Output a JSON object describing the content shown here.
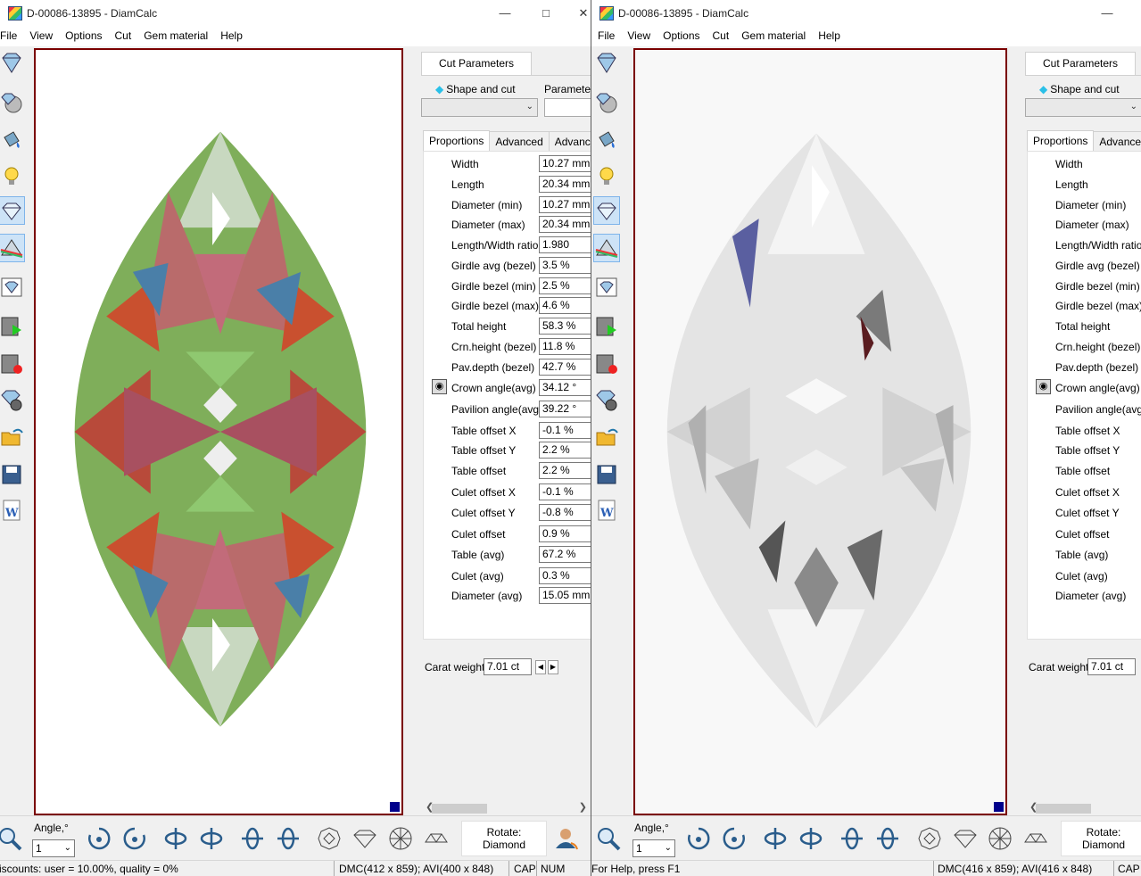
{
  "windows": [
    {
      "title": "D-00086-13895 - DiamCalc",
      "menu": [
        "File",
        "View",
        "Options",
        "Cut",
        "Gem material",
        "Help"
      ],
      "panel_tab": "Cut Parameters",
      "shape_label": "Shape and cut",
      "parameter_label": "Parameter",
      "subtabs": [
        "Proportions",
        "Advanced",
        "Advanced"
      ],
      "params": [
        {
          "label": "Width",
          "value": "10.27 mm"
        },
        {
          "label": "Length",
          "value": "20.34 mm"
        },
        {
          "label": "Diameter (min)",
          "value": "10.27 mm"
        },
        {
          "label": "Diameter (max)",
          "value": "20.34 mm"
        },
        {
          "label": "Length/Width ratio",
          "value": "1.980"
        },
        {
          "label": "Girdle avg (bezel)",
          "value": "3.5 %"
        },
        {
          "label": "Girdle bezel (min)",
          "value": "2.5 %"
        },
        {
          "label": "Girdle bezel (max)",
          "value": "4.6 %"
        },
        {
          "label": "Total height",
          "value": "58.3 %"
        },
        {
          "label": "Crn.height (bezel)",
          "value": "11.8 %"
        },
        {
          "label": "Pav.depth (bezel)",
          "value": "42.7 %"
        },
        {
          "label": "Crown angle(avg)",
          "value": "34.12 °"
        },
        {
          "label": "Pavilion angle(avg)",
          "value": "39.22 °"
        },
        {
          "label": "Table offset X",
          "value": "-0.1 %"
        },
        {
          "label": "Table offset Y",
          "value": "2.2 %"
        },
        {
          "label": "Table offset",
          "value": "2.2 %"
        },
        {
          "label": "Culet offset X",
          "value": "-0.1 %"
        },
        {
          "label": "Culet offset Y",
          "value": "-0.8 %"
        },
        {
          "label": "Culet offset",
          "value": "0.9 %"
        },
        {
          "label": "Table (avg)",
          "value": "67.2 %"
        },
        {
          "label": "Culet (avg)",
          "value": "0.3 %"
        },
        {
          "label": "Diameter (avg)",
          "value": "15.05 mm"
        }
      ],
      "carat_label": "Carat weight",
      "carat_value": "7.01 ct",
      "angle_label": "Angle,°",
      "angle_value": "1",
      "rotate_label": "Rotate:",
      "rotate_value": "Diamond",
      "status_left": "iscounts: user = 10.00%, quality = 0%",
      "status_dmc": "DMC(412 x 859); AVI(400 x 848)",
      "status_cap": "CAP",
      "status_num": "NUM"
    },
    {
      "title": "D-00086-13895 - DiamCalc",
      "menu": [
        "File",
        "View",
        "Options",
        "Cut",
        "Gem material",
        "Help"
      ],
      "panel_tab": "Cut Parameters",
      "shape_label": "Shape and cut",
      "subtabs": [
        "Proportions",
        "Advanced"
      ],
      "params": [
        "Width",
        "Length",
        "Diameter (min)",
        "Diameter (max)",
        "Length/Width ratio",
        "Girdle avg (bezel)",
        "Girdle bezel (min)",
        "Girdle bezel (max)",
        "Total height",
        "Crn.height (bezel)",
        "Pav.depth (bezel)",
        "Crown angle(avg)",
        "Pavilion angle(avg)",
        "Table offset X",
        "Table offset Y",
        "Table offset",
        "Culet offset X",
        "Culet offset Y",
        "Culet offset",
        "Table (avg)",
        "Culet (avg)",
        "Diameter (avg)"
      ],
      "carat_label": "Carat weight",
      "carat_value": "7.01 ct",
      "angle_label": "Angle,°",
      "angle_value": "1",
      "rotate_label": "Rotate:",
      "rotate_value": "Diamond",
      "status_left": "For Help, press F1",
      "status_dmc": "DMC(416 x 859); AVI(416 x 848)",
      "status_cap": "CAP"
    }
  ],
  "icons": {
    "toolbar": [
      "diamond-icon",
      "gem-globe-icon",
      "paint-bucket-icon",
      "light-bulb-icon",
      "diamond-view-icon",
      "prism-icon",
      "diamond-image-icon",
      "video-play-icon",
      "video-record-icon",
      "gem-settings-icon",
      "open-folder-icon",
      "save-icon",
      "word-export-icon"
    ],
    "bottom": [
      "zoom-icon",
      "rotate-cw-icon",
      "rotate-ccw-icon",
      "flip-left-icon",
      "flip-right-icon",
      "turn-left-icon",
      "turn-right-icon",
      "top-view-icon",
      "side-view-icon",
      "face-view-icon",
      "pavilion-view-icon",
      "user-rotate-icon"
    ]
  },
  "colors": {
    "viewport_border": "#7a0000",
    "gem_blue": "#2ac0e8"
  }
}
